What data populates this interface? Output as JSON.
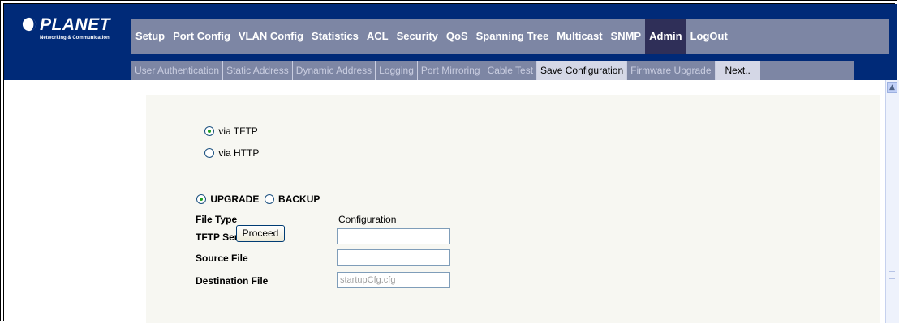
{
  "brand": {
    "name": "PLANET",
    "tagline": "Networking & Communication"
  },
  "main_nav": {
    "items": [
      {
        "label": "Setup"
      },
      {
        "label": "Port Config"
      },
      {
        "label": "VLAN Config"
      },
      {
        "label": "Statistics"
      },
      {
        "label": "ACL"
      },
      {
        "label": "Security"
      },
      {
        "label": "QoS"
      },
      {
        "label": "Spanning Tree"
      },
      {
        "label": "Multicast"
      },
      {
        "label": "SNMP"
      },
      {
        "label": "Admin"
      },
      {
        "label": "LogOut"
      }
    ],
    "active": "Admin"
  },
  "sub_nav": {
    "items": [
      {
        "label": "User Authentication"
      },
      {
        "label": "Static Address"
      },
      {
        "label": "Dynamic Address"
      },
      {
        "label": "Logging"
      },
      {
        "label": "Port Mirroring"
      },
      {
        "label": "Cable Test"
      },
      {
        "label": "Save Configuration"
      },
      {
        "label": "Firmware Upgrade"
      },
      {
        "label": "Next.."
      }
    ],
    "active": "Save Configuration"
  },
  "transfer": {
    "via_tftp": "via TFTP",
    "via_http": "via HTTP",
    "selected": "via TFTP"
  },
  "mode": {
    "upgrade": "UPGRADE",
    "backup": "BACKUP",
    "selected": "UPGRADE"
  },
  "form": {
    "file_type_label": "File Type",
    "file_type_value": "Configuration",
    "tftp_server_label": "TFTP Server",
    "tftp_server_value": "",
    "source_file_label": "Source File",
    "source_file_value": "",
    "destination_file_label": "Destination File",
    "destination_file_value": "startupCfg.cfg"
  },
  "actions": {
    "proceed": "Proceed"
  },
  "colors": {
    "header_bg": "#002a78",
    "nav_bg": "#7d86a4",
    "nav_active": "#2f2f58",
    "panel_bg": "#f7f7f2"
  }
}
